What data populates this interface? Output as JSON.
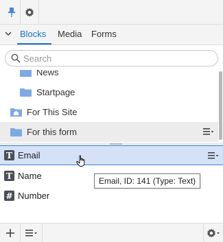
{
  "toolbar": {
    "pin_icon": "pin-icon",
    "gear_icon": "gear-icon"
  },
  "tabs": [
    {
      "label": "Blocks",
      "active": true
    },
    {
      "label": "Media",
      "active": false
    },
    {
      "label": "Forms",
      "active": false
    }
  ],
  "search": {
    "placeholder": "Search",
    "value": ""
  },
  "tree": {
    "items": [
      {
        "label": "News",
        "icon": "folder-icon"
      },
      {
        "label": "Startpage",
        "icon": "folder-icon"
      },
      {
        "label": "For This Site",
        "icon": "site-folder-icon"
      },
      {
        "label": "For this form",
        "icon": "folder-icon",
        "hovered": true
      }
    ]
  },
  "list": {
    "items": [
      {
        "label": "Email",
        "type_glyph": "T",
        "icon": "text-type-icon",
        "selected": true
      },
      {
        "label": "Name",
        "type_glyph": "T",
        "icon": "text-type-icon",
        "selected": false
      },
      {
        "label": "Number",
        "type_glyph": "#",
        "icon": "number-type-icon",
        "selected": false
      }
    ]
  },
  "tooltip": {
    "text": "Email, ID: 141 (Type: Text)"
  },
  "bottom_toolbar": {
    "add_icon": "plus-icon",
    "menu_icon": "menu-icon",
    "settings_icon": "settings-icon"
  },
  "colors": {
    "accent": "#1a73c9",
    "folder": "#7fa9e6",
    "selected_bg": "#d4e1f7",
    "selected_border": "#3d7fd6",
    "hover_bg": "#ececec",
    "toolbar_bg": "#f4f4f4"
  }
}
